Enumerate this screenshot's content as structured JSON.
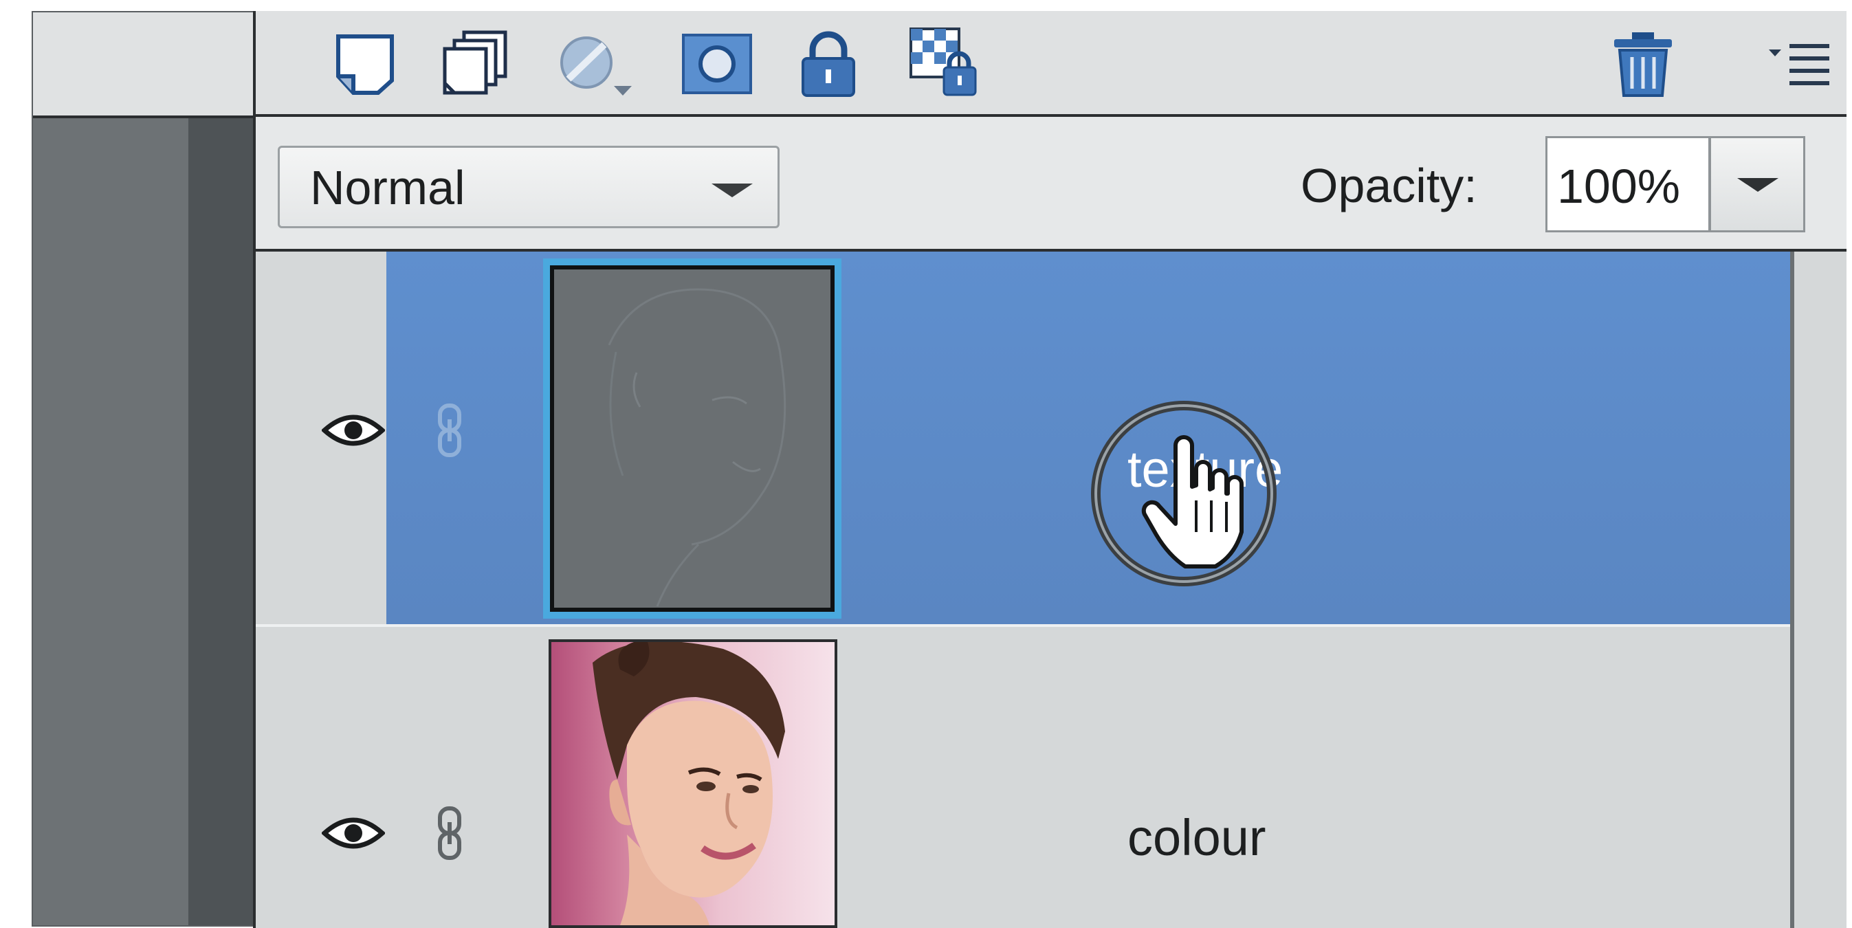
{
  "toolbar": {
    "icons": [
      "new-layer-icon",
      "new-group-icon",
      "adjustment-layer-icon",
      "layer-mask-icon",
      "lock-all-icon",
      "lock-transparency-icon",
      "delete-layer-icon",
      "panel-menu-icon"
    ]
  },
  "blend": {
    "mode": "Normal",
    "opacity_label": "Opacity:",
    "opacity_value": "100%"
  },
  "layers": [
    {
      "name": "texture",
      "selected": true,
      "visible": true
    },
    {
      "name": "colour",
      "selected": false,
      "visible": true
    }
  ],
  "colors": {
    "selected_layer": "#5f8fce",
    "thumb_highlight": "#4aa9de",
    "panel_bg": "#d5d8d9"
  }
}
